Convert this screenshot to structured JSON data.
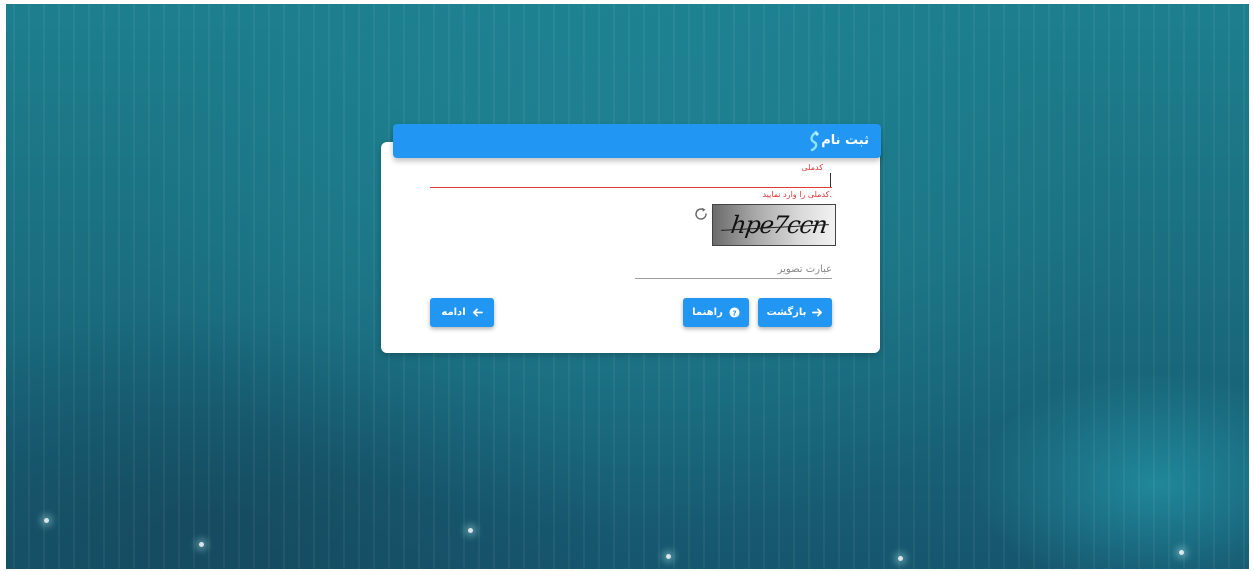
{
  "header": {
    "title": "ثبت نام",
    "logo_icon": "logo-icon"
  },
  "national_code": {
    "label": "کدملی",
    "value": "",
    "error": "کدملی را وارد نمایید."
  },
  "captcha": {
    "text": "hpe7ccn",
    "refresh_icon": "refresh-icon"
  },
  "captcha_input": {
    "placeholder": "عبارت تصویر",
    "value": ""
  },
  "buttons": {
    "back": {
      "label": "بازگشت",
      "icon": "arrow-right-icon"
    },
    "help": {
      "label": "راهنما",
      "icon": "help-circle-icon"
    },
    "next": {
      "label": "ادامه",
      "icon": "arrow-left-icon"
    }
  },
  "colors": {
    "primary": "#2196f3",
    "error": "#e53935",
    "background": "#1a6f80"
  }
}
